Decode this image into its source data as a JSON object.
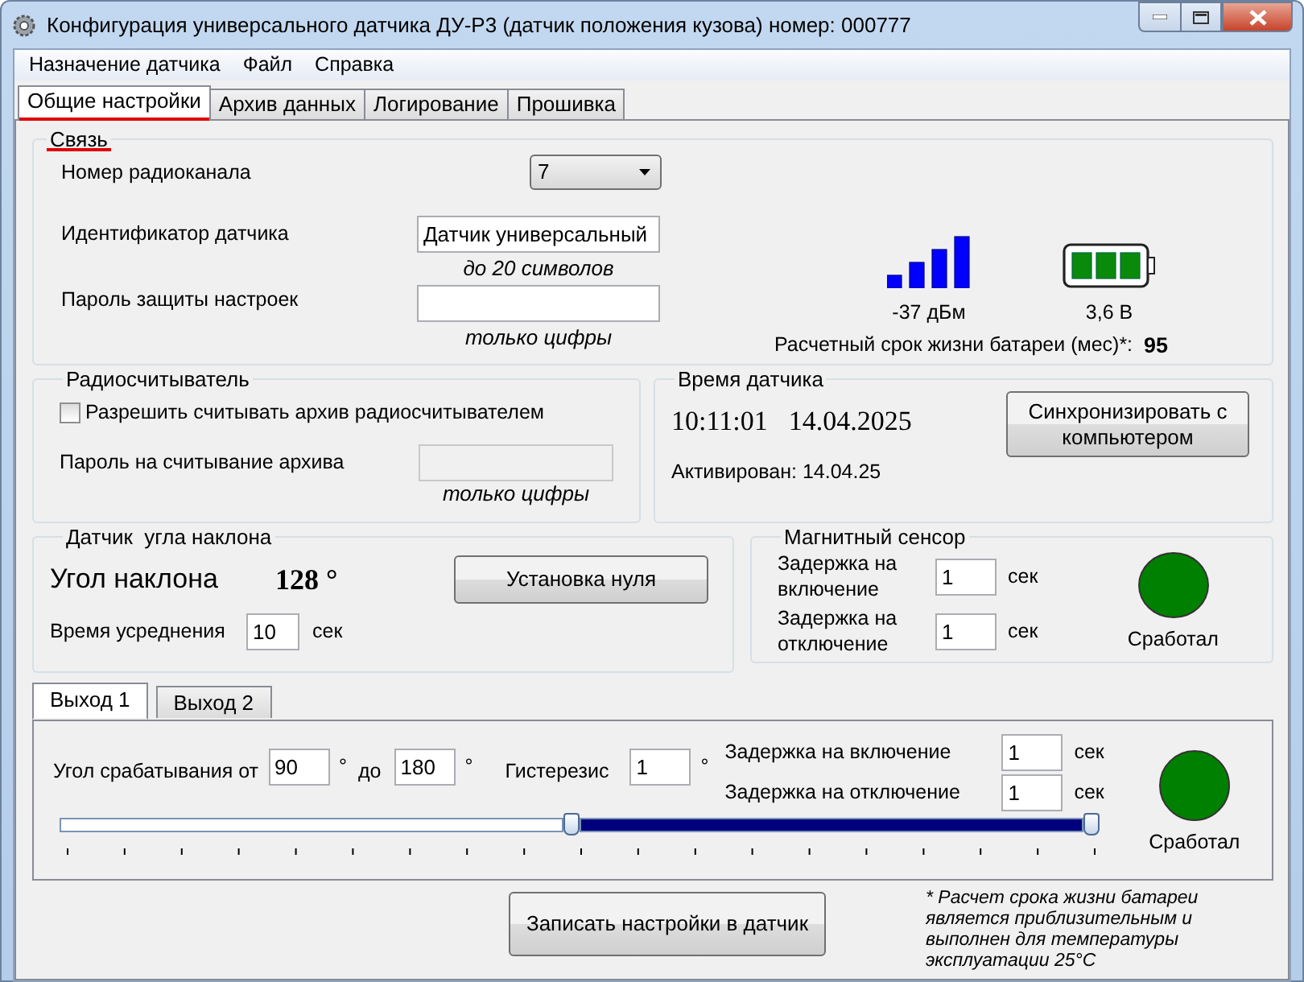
{
  "window": {
    "title": "Конфигурация универсального датчика ДУ-Р3 (датчик положения кузова) номер: 000777"
  },
  "menu": [
    "Назначение датчика",
    "Файл",
    "Справка"
  ],
  "tabs": [
    {
      "label": "Общие настройки",
      "selected": true,
      "highlighted": true
    },
    {
      "label": "Архив данных",
      "selected": false,
      "highlighted": false
    },
    {
      "label": "Логирование",
      "selected": false,
      "highlighted": false
    },
    {
      "label": "Прошивка",
      "selected": false,
      "highlighted": false
    }
  ],
  "link": {
    "title": "Связь",
    "title_highlighted": true,
    "channel_label": "Номер радиоканала",
    "channel_value": "7",
    "id_label": "Идентификатор датчика",
    "id_value": "Датчик универсальный",
    "id_hint": "до 20 символов",
    "password_label": "Пароль защиты настроек",
    "password_hint": "только цифры",
    "signal_reading": "-37 дБм",
    "battery_reading": "3,6 В",
    "lifetime_label": "Расчетный срок жизни батареи (мес)*:",
    "lifetime_value": "95"
  },
  "radio_reader": {
    "title": "Радиосчитыватель",
    "allow_label": "Разрешить считывать архив радиосчитывателем",
    "allow_checked": false,
    "password_label": "Пароль на считывание архива",
    "password_disabled": true,
    "password_hint": "только цифры"
  },
  "sensor_time": {
    "title": "Время датчика",
    "time": "10:11:01",
    "date": "14.04.2025",
    "sync_button": "Синхронизировать с компьютером",
    "activated": "Активирован: 14.04.25"
  },
  "tilt": {
    "title": "Датчик  угла наклона",
    "angle_label": "Угол наклона",
    "angle_value": "128 °",
    "zero_button": "Установка нуля",
    "avg_label": "Время усреднения",
    "avg_value": "10",
    "avg_unit": "сек"
  },
  "magnet": {
    "title": "Магнитный сенсор",
    "delays": [
      {
        "label": "Задержка на включение",
        "value": "1",
        "unit": "сек"
      },
      {
        "label": "Задержка на отключение",
        "value": "1",
        "unit": "сек"
      }
    ],
    "indicator_label": "Сработал",
    "indicator_on": true
  },
  "output_tabs": [
    {
      "label": "Выход 1",
      "selected": true
    },
    {
      "label": "Выход 2",
      "selected": false
    }
  ],
  "output": {
    "angle_label": "Угол срабатывания от",
    "from_value": "90",
    "from_unit": "°",
    "to_label": "до",
    "to_value": "180",
    "to_unit": "°",
    "hyst_label": "Гистерезис",
    "hyst_value": "1",
    "hyst_unit": "°",
    "delays": [
      {
        "label": "Задержка на включение",
        "value": "1",
        "unit": "сек"
      },
      {
        "label": "Задержка на отключение",
        "value": "1",
        "unit": "сек"
      }
    ],
    "thumbs": [
      {
        "level": 0.5
      },
      {
        "level": 1
      }
    ],
    "indicator_label": "Сработал",
    "indicator_on": true
  },
  "write_button": "Записать настройки в датчик",
  "footnote": "* Расчет срока жизни батареи является приблизительным и выполнен для температуры эксплуатации 25°C"
}
